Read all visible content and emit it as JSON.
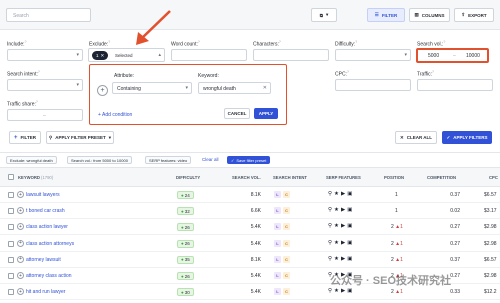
{
  "toolbar": {
    "search_placeholder": "Search",
    "filter_label": "FILTER",
    "columns_label": "COLUMNS",
    "export_label": "EXPORT"
  },
  "filters": {
    "include_label": "Include:",
    "exclude_label": "Exclude:",
    "exclude_chip": "1",
    "exclude_selected": "Selected",
    "word_count_label": "Word count:",
    "characters_label": "Characters:",
    "difficulty_label": "Difficulty:",
    "search_vol_label": "Search vol.:",
    "search_vol_min": "5000",
    "search_vol_max": "10000",
    "search_intent_label": "Search intent:",
    "cpc_label": "CPC:",
    "traffic_label": "Traffic:",
    "traffic_share_label": "Traffic share:",
    "dash": "–"
  },
  "popover": {
    "attribute_label": "Attribute:",
    "attribute_value": "Containing",
    "keyword_label": "Keyword:",
    "keyword_value": "wrongful death",
    "add_condition": "+ Add condition",
    "cancel_label": "CANCEL",
    "apply_label": "APPLY"
  },
  "actionbar": {
    "filter_label": "FILTER",
    "apply_preset_label": "APPLY FILTER PRESET",
    "clear_all_label": "CLEAR ALL",
    "apply_filters_label": "APPLY FILTERS"
  },
  "active_chips": [
    "Exclude: wrongful death",
    "Search vol.: from 5000 to 10000",
    "SERP features: video"
  ],
  "clear_all_link": "Clear all",
  "save_preset_label": "Save filter preset",
  "table": {
    "headers": {
      "keyword": "KEYWORD",
      "keyword_count": "(1790)",
      "difficulty": "DIFFICULTY",
      "search_vol": "SEARCH VOL.",
      "search_intent": "SEARCH INTENT",
      "serp_features": "SERP FEATURES",
      "position": "POSITION",
      "competition": "COMPETITION",
      "cpc": "CPC"
    },
    "rows": [
      {
        "keyword": "lawsuit lawyers",
        "difficulty": "24",
        "vol": "8.1K",
        "pos": "1",
        "pos_change": "",
        "competition": "0.37",
        "cpc": "$6.57"
      },
      {
        "keyword": "t boned car crash",
        "difficulty": "32",
        "vol": "6.6K",
        "pos": "1",
        "pos_change": "",
        "competition": "0.02",
        "cpc": "$3.17"
      },
      {
        "keyword": "class action lawyer",
        "difficulty": "26",
        "vol": "5.4K",
        "pos": "2",
        "pos_change": "1",
        "competition": "0.27",
        "cpc": "$2.98"
      },
      {
        "keyword": "class action attorneys",
        "difficulty": "26",
        "vol": "5.4K",
        "pos": "2",
        "pos_change": "1",
        "competition": "0.27",
        "cpc": "$2.98"
      },
      {
        "keyword": "attorney lawsuit",
        "difficulty": "35",
        "vol": "8.1K",
        "pos": "2",
        "pos_change": "1",
        "competition": "0.37",
        "cpc": "$6.57"
      },
      {
        "keyword": "attorney class action",
        "difficulty": "26",
        "vol": "5.4K",
        "pos": "2",
        "pos_change": "1",
        "competition": "0.27",
        "cpc": "$2.98"
      },
      {
        "keyword": "hit and run lawyer",
        "difficulty": "30",
        "vol": "5.4K",
        "pos": "2",
        "pos_change": "1",
        "competition": "0.33",
        "cpc": "$12.2"
      }
    ]
  },
  "intent_letters": [
    "L",
    "C"
  ],
  "watermark": "公众号 · SEO技术研究社",
  "colors": {
    "accent": "#3152d6",
    "highlight": "#e2512e",
    "difficulty_green": "#3ba935",
    "position_up": "#d33b3b"
  }
}
